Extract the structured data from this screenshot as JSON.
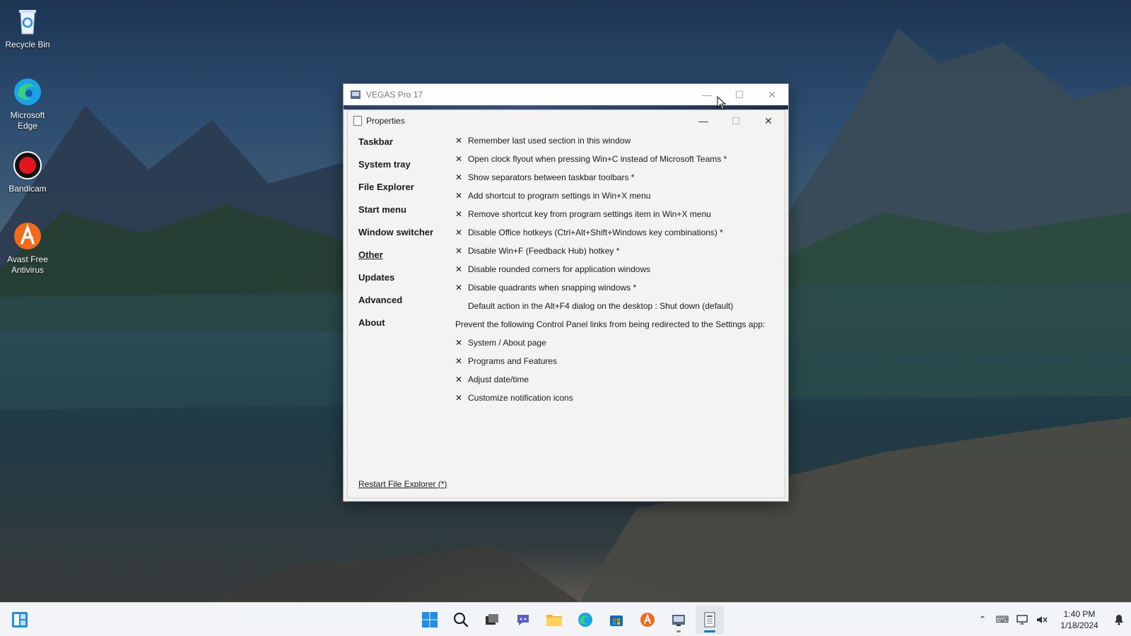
{
  "desktop": {
    "icons": [
      {
        "label": "Recycle Bin"
      },
      {
        "label": "Microsoft Edge"
      },
      {
        "label": "Bandicam"
      },
      {
        "label": "Avast Free Antivirus"
      }
    ]
  },
  "vegas": {
    "title": "VEGAS Pro 17"
  },
  "properties": {
    "title": "Properties",
    "nav": [
      {
        "label": "Taskbar"
      },
      {
        "label": "System tray"
      },
      {
        "label": "File Explorer"
      },
      {
        "label": "Start menu"
      },
      {
        "label": "Window switcher"
      },
      {
        "label": "Other"
      },
      {
        "label": "Updates"
      },
      {
        "label": "Advanced"
      },
      {
        "label": "About"
      }
    ],
    "check_mark": "✕",
    "options": [
      {
        "label": "Remember last used section in this window"
      },
      {
        "label": "Open clock flyout when pressing Win+C instead of Microsoft Teams *"
      },
      {
        "label": "Show separators between taskbar toolbars *"
      },
      {
        "label": "Add shortcut to program settings in Win+X menu"
      },
      {
        "label": "Remove shortcut key from program settings item in Win+X menu"
      },
      {
        "label": "Disable Office hotkeys (Ctrl+Alt+Shift+Windows key combinations) *"
      },
      {
        "label": "Disable Win+F (Feedback Hub) hotkey *"
      },
      {
        "label": "Disable rounded corners for application windows"
      },
      {
        "label": "Disable quadrants when snapping windows *"
      },
      {
        "label": "Default action in the Alt+F4 dialog on the desktop : Shut down (default)"
      },
      {
        "label": "Prevent the following Control Panel links from being redirected to the Settings app:"
      },
      {
        "label": "System / About page"
      },
      {
        "label": "Programs and Features"
      },
      {
        "label": "Adjust date/time"
      },
      {
        "label": "Customize notification icons"
      }
    ],
    "restart_link": "Restart File Explorer (*)"
  },
  "taskbar": {
    "clock_time": "1:40 PM",
    "clock_date": "1/18/2024"
  },
  "colors": {
    "accent": "#0a7dd4",
    "windows_logo": "#1e90e8"
  }
}
